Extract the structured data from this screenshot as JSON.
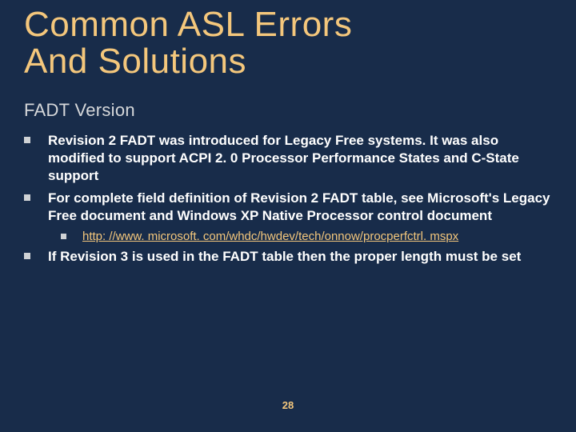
{
  "title_line1": "Common ASL Errors",
  "title_line2": "And Solutions",
  "subtitle": "FADT Version",
  "bullets": {
    "b1": "Revision 2 FADT was introduced for Legacy Free systems. It was also modified to support ACPI 2. 0 Processor Performance States and C-State support",
    "b2": "For complete field definition of Revision 2 FADT table, see Microsoft's Legacy Free document and Windows XP Native Processor control document",
    "b2_sub_link": "http: //www. microsoft. com/whdc/hwdev/tech/onnow/procperfctrl. mspx",
    "b3": "If Revision 3 is used in the FADT table then the proper length must be set"
  },
  "page_number": "28"
}
